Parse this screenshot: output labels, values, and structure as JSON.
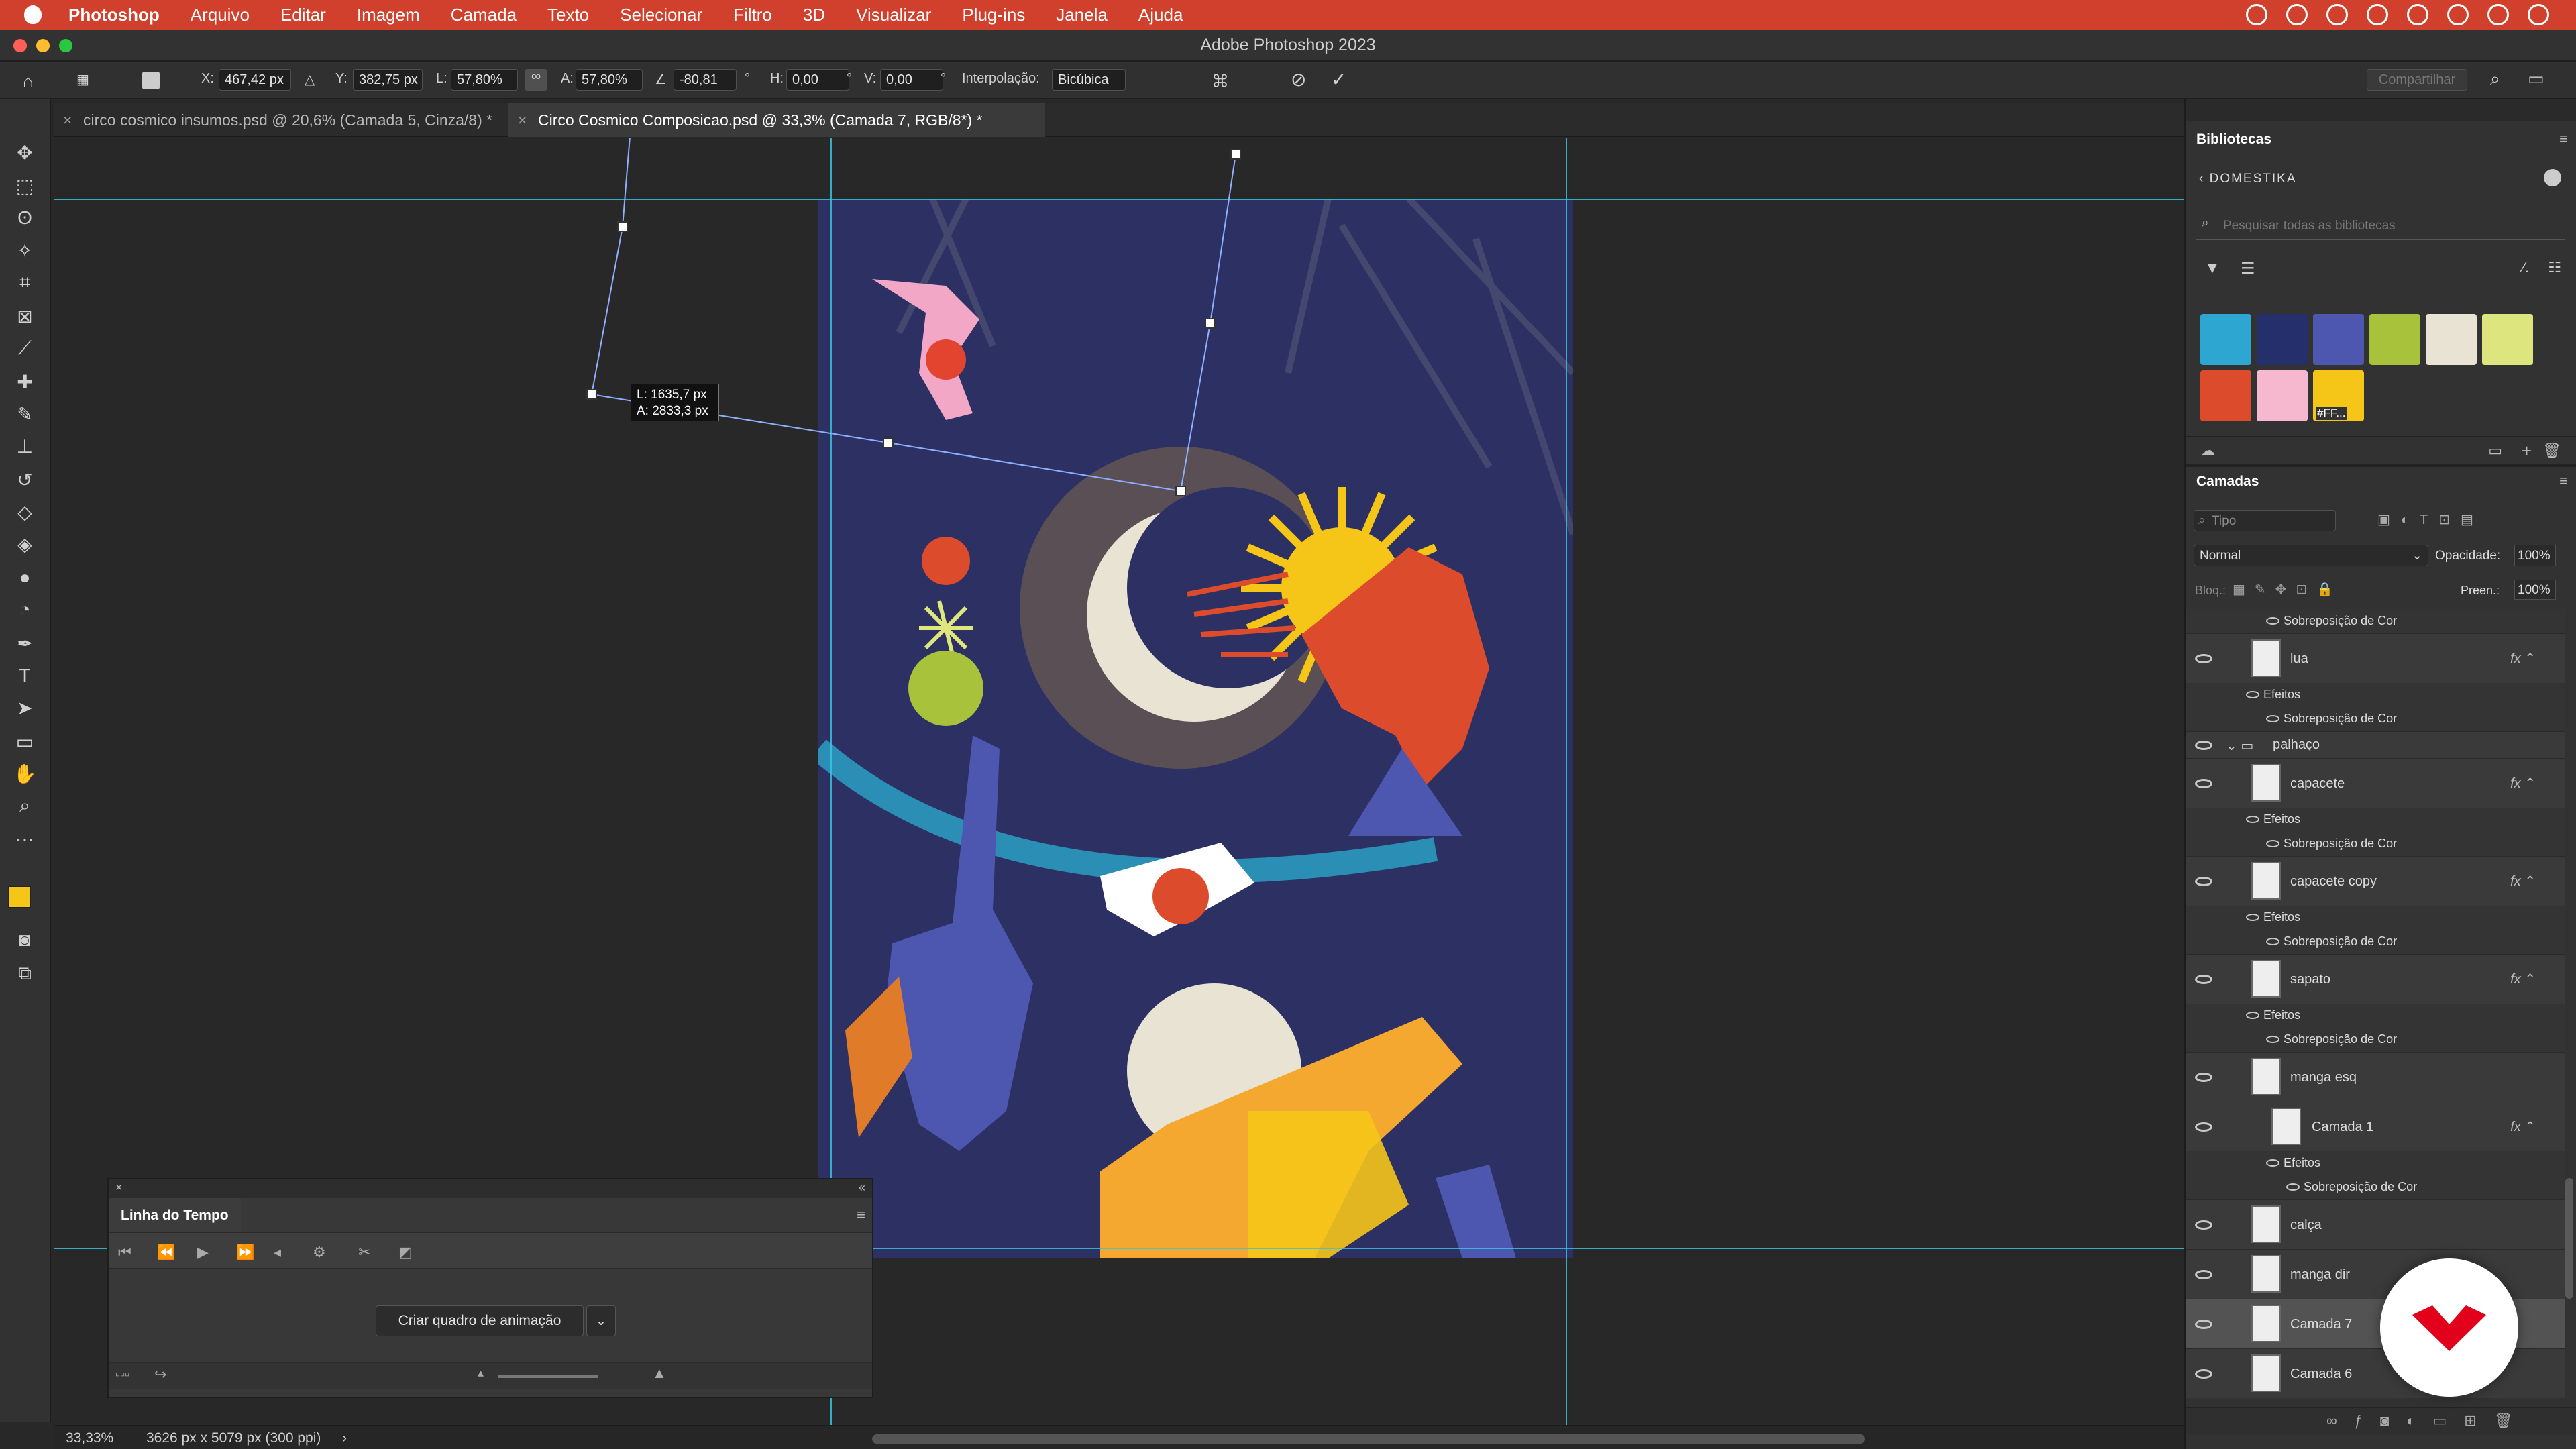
{
  "menu": {
    "app": "Photoshop",
    "items": [
      "Arquivo",
      "Editar",
      "Imagem",
      "Camada",
      "Texto",
      "Selecionar",
      "Filtro",
      "3D",
      "Visualizar",
      "Plug-ins",
      "Janela",
      "Ajuda"
    ]
  },
  "window": {
    "title": "Adobe Photoshop 2023"
  },
  "options": {
    "x_label": "X:",
    "x": "467,42 px",
    "y_label": "Y:",
    "y": "382,75 px",
    "w_label": "L:",
    "w": "57,80%",
    "h_label": "A:",
    "h": "57,80%",
    "angle": "-80,81",
    "angle_unit": "°",
    "hs_label": "H:",
    "hs": "0,00",
    "vs_label": "V:",
    "vs": "0,00",
    "deg": "°",
    "interp_label": "Interpolação:",
    "interp": "Bicúbica",
    "share": "Compartilhar"
  },
  "tabs": [
    {
      "label": "circo cosmico insumos.psd @ 20,6% (Camada 5, Cinza/8) *",
      "active": false
    },
    {
      "label": "Circo Cosmico Composicao.psd @ 33,3% (Camada 7, RGB/8*) *",
      "active": true
    }
  ],
  "tooltip": {
    "line1": "L: 1635,7 px",
    "line2": "A: 2833,3 px"
  },
  "timeline": {
    "title": "Linha do Tempo",
    "create_button": "Criar quadro de animação"
  },
  "status": {
    "zoom": "33,33%",
    "doc": "3626 px x 5079 px (300 ppi)",
    "arrow": "›"
  },
  "libraries": {
    "title": "Bibliotecas",
    "back_label": "DOMESTIKA",
    "search_placeholder": "Pesquisar todas as bibliotecas",
    "swatch_label": "#FF...",
    "swatches": [
      "#2ea6d2",
      "#242f6b",
      "#4e57b0",
      "#a8c23c",
      "#e8e3d2",
      "#dde67e",
      "#dc4b2c",
      "#f5b8cf",
      "#f5c518"
    ]
  },
  "layers": {
    "title": "Camadas",
    "filter_placeholder": "Tipo",
    "blend_mode": "Normal",
    "opacity_label": "Opacidade:",
    "opacity": "100%",
    "lock_label": "Bloq.:",
    "fill_label": "Preen.:",
    "fill": "100%",
    "rows": [
      {
        "kind": "sub",
        "label": "Sobreposição de Cor",
        "indent": 2
      },
      {
        "kind": "main",
        "label": "lua",
        "fx": true
      },
      {
        "kind": "sub",
        "label": "Efeitos",
        "indent": 1
      },
      {
        "kind": "sub",
        "label": "Sobreposição de Cor",
        "indent": 2
      },
      {
        "kind": "group",
        "label": "palhaço"
      },
      {
        "kind": "main",
        "label": "capacete",
        "fx": true
      },
      {
        "kind": "sub",
        "label": "Efeitos",
        "indent": 1
      },
      {
        "kind": "sub",
        "label": "Sobreposição de Cor",
        "indent": 2
      },
      {
        "kind": "main",
        "label": "capacete copy",
        "fx": true
      },
      {
        "kind": "sub",
        "label": "Efeitos",
        "indent": 1
      },
      {
        "kind": "sub",
        "label": "Sobreposição de Cor",
        "indent": 2
      },
      {
        "kind": "main",
        "label": "sapato",
        "fx": true
      },
      {
        "kind": "sub",
        "label": "Efeitos",
        "indent": 1
      },
      {
        "kind": "sub",
        "label": "Sobreposição de Cor",
        "indent": 2
      },
      {
        "kind": "main",
        "label": "manga esq",
        "fx": false
      },
      {
        "kind": "main",
        "label": "Camada 1",
        "fx": true,
        "clip": true
      },
      {
        "kind": "sub",
        "label": "Efeitos",
        "indent": 2
      },
      {
        "kind": "sub",
        "label": "Sobreposição de Cor",
        "indent": 3
      },
      {
        "kind": "main",
        "label": "calça",
        "fx": false
      },
      {
        "kind": "main",
        "label": "manga dir",
        "fx": false
      },
      {
        "kind": "main",
        "label": "Camada 7",
        "fx": false,
        "selected": true
      },
      {
        "kind": "main",
        "label": "Camada 6",
        "fx": false
      }
    ]
  },
  "colors": {
    "accent": "#d0402c",
    "guide": "#3ac3e0",
    "fg": "#f5c518",
    "bg": "#ffffff"
  }
}
